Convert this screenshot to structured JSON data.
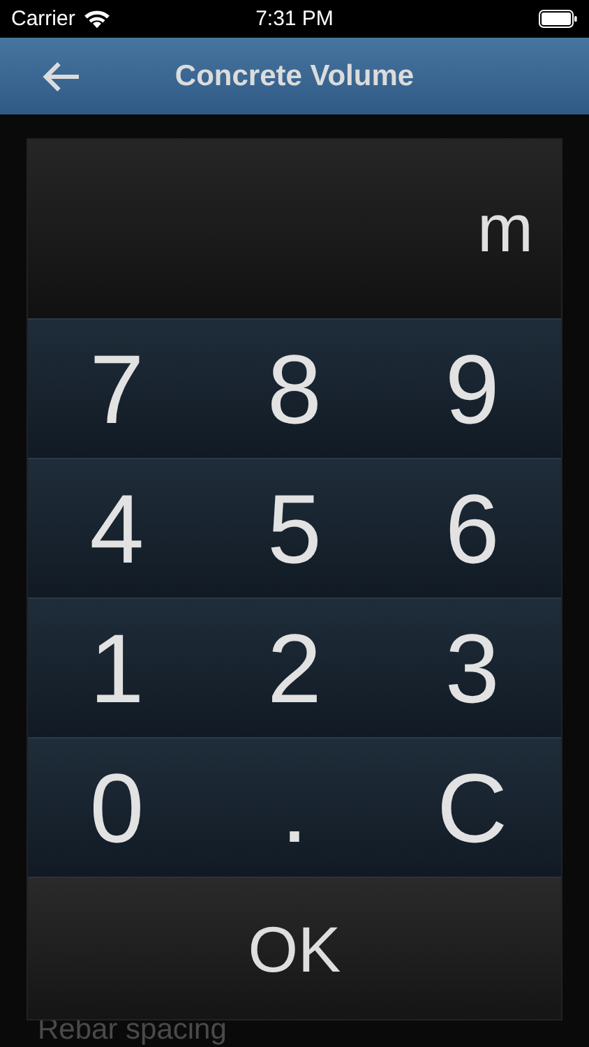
{
  "status_bar": {
    "carrier": "Carrier",
    "time": "7:31 PM"
  },
  "header": {
    "title": "Concrete Volume"
  },
  "background_fields": [
    {
      "label": "Rebar spacing"
    }
  ],
  "keypad": {
    "display_unit": "m",
    "rows": [
      [
        "7",
        "8",
        "9"
      ],
      [
        "4",
        "5",
        "6"
      ],
      [
        "1",
        "2",
        "3"
      ],
      [
        "0",
        ".",
        "C"
      ]
    ],
    "ok_label": "OK"
  }
}
